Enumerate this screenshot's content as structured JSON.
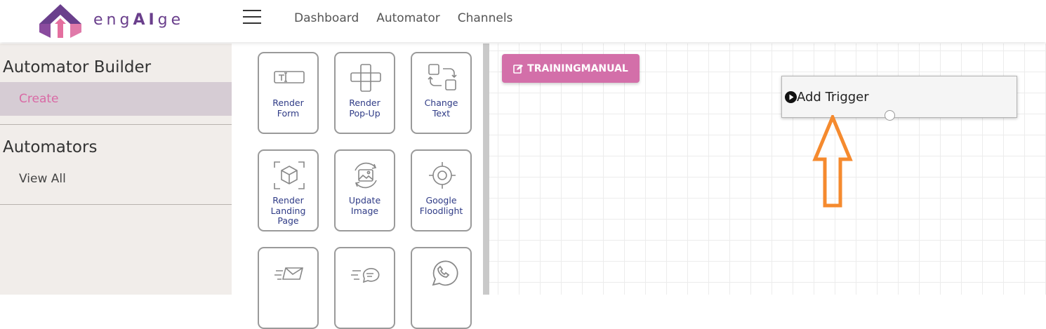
{
  "brand": {
    "name_prefix": "eng",
    "name_bold": "AI",
    "name_suffix": "ge",
    "logo_icon": "upload-arrow-logo"
  },
  "nav": {
    "items": [
      "Dashboard",
      "Automator",
      "Channels"
    ]
  },
  "sidebar": {
    "section1_title": "Automator Builder",
    "section1_item": "Create",
    "section2_title": "Automators",
    "section2_item": "View All"
  },
  "palette": {
    "tiles": [
      {
        "label": "Render\nForm",
        "icon": "text-field-icon"
      },
      {
        "label": "Render\nPop-Up",
        "icon": "popup-icon"
      },
      {
        "label": "Change\nText",
        "icon": "swap-icon"
      },
      {
        "label": "Render\nLanding\nPage",
        "icon": "cube-icon"
      },
      {
        "label": "Update\nImage",
        "icon": "image-refresh-icon"
      },
      {
        "label": "Google\nFloodlight",
        "icon": "target-icon"
      },
      {
        "label": "",
        "icon": "fast-email-icon"
      },
      {
        "label": "",
        "icon": "fast-chat-icon"
      },
      {
        "label": "",
        "icon": "whatsapp-icon"
      }
    ]
  },
  "canvas": {
    "button_label": "TRAININGMANUAL",
    "node_label": "Add Trigger"
  },
  "colors": {
    "accent_pink": "#d36fa9",
    "brand_purple": "#6a3f8c",
    "annotation_orange": "#f58a2e",
    "tile_text": "#2f3b86"
  }
}
